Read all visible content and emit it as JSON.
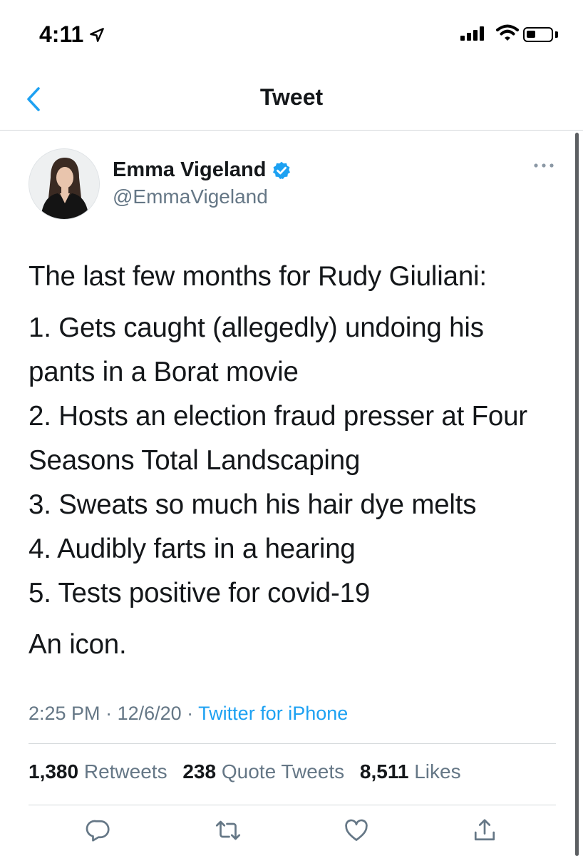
{
  "status_bar": {
    "time": "4:11"
  },
  "nav": {
    "title": "Tweet"
  },
  "tweet": {
    "author": {
      "display_name": "Emma Vigeland",
      "handle": "@EmmaVigeland",
      "verified": true
    },
    "text": {
      "intro": "The last few months for Rudy Giuliani:",
      "items": [
        "1. Gets caught (allegedly) undoing his pants in a Borat movie",
        "2. Hosts an election fraud presser at Four Seasons Total Landscaping",
        "3. Sweats so much his hair dye melts",
        "4. Audibly farts in a hearing",
        "5. Tests positive for covid-19"
      ],
      "closing": "An icon."
    },
    "time": "2:25 PM",
    "date": "12/6/20",
    "separator": " · ",
    "source": "Twitter for iPhone",
    "stats": {
      "retweets_count": "1,380",
      "retweets_label": "Retweets",
      "quotes_count": "238",
      "quotes_label": "Quote Tweets",
      "likes_count": "8,511",
      "likes_label": "Likes"
    }
  },
  "colors": {
    "accent": "#1da1f2",
    "text": "#14171a",
    "secondary": "#657786",
    "divider": "#d4d8db"
  },
  "icons": [
    "location-arrow-icon",
    "cellular-signal-icon",
    "wifi-icon",
    "battery-icon",
    "back-chevron-icon",
    "verified-badge-icon",
    "more-options-icon",
    "reply-icon",
    "retweet-icon",
    "like-icon",
    "share-icon"
  ]
}
